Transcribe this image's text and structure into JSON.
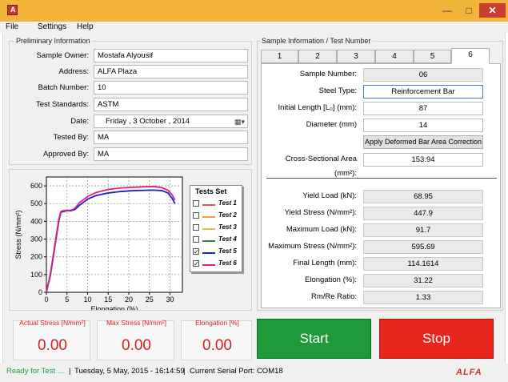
{
  "window": {
    "minimize": "—",
    "maximize": "□",
    "close": "✕",
    "icon": "alfa-app-icon"
  },
  "menu": [
    "File",
    "Settings",
    "Help"
  ],
  "preliminary": {
    "title": "Preliminary Information",
    "fields": [
      {
        "label": "Sample Owner:",
        "value": "Mostafa Alyousif"
      },
      {
        "label": "Address:",
        "value": "ALFA Plaza"
      },
      {
        "label": "Batch Number:",
        "value": "10"
      },
      {
        "label": "Test Standards:",
        "value": "ASTM"
      },
      {
        "label": "Date:",
        "value": "Friday    ,    3    October    , 2014"
      },
      {
        "label": "Tested By:",
        "value": "MA"
      },
      {
        "label": "Approved By:",
        "value": "MA"
      }
    ]
  },
  "sample_info": {
    "title": "Sample Information / Test Number",
    "tabs": [
      "1",
      "2",
      "3",
      "4",
      "5",
      "6"
    ],
    "active_tab": "6",
    "inputs": [
      {
        "label": "Sample Number:",
        "value": "06",
        "readonly": true
      },
      {
        "label": "Steel Type:",
        "value": "Reinforcement Bar",
        "readonly": false
      },
      {
        "label": "Initial Length [L₀] (mm):",
        "value": "87",
        "readonly": false
      },
      {
        "label": "Diameter (mm)",
        "value": "14",
        "readonly": false
      }
    ],
    "correction_button": "Apply Deformed Bar Area Correction",
    "area_label": "Cross-Sectional Area (mm²):",
    "area_value": "153.94",
    "results": [
      {
        "label": "Yield Load (kN):",
        "value": "68.95"
      },
      {
        "label": "Yield Stress (N/mm²):",
        "value": "447.9"
      },
      {
        "label": "Maximum Load (kN):",
        "value": "91.7"
      },
      {
        "label": "Maximum Stress (N/mm²):",
        "value": "595.69"
      },
      {
        "label": "Final Length (mm):",
        "value": "114.1614"
      },
      {
        "label": "Elongation (%):",
        "value": "31.22"
      },
      {
        "label": "Rm/Re Ratio:",
        "value": "1.33"
      }
    ]
  },
  "tests_set": {
    "title": "Tests Set",
    "items": [
      {
        "label": "Test 1",
        "checked": false,
        "color": "#d9534f"
      },
      {
        "label": "Test 2",
        "checked": false,
        "color": "#e8a040"
      },
      {
        "label": "Test 3",
        "checked": false,
        "color": "#d8c640"
      },
      {
        "label": "Test 4",
        "checked": false,
        "color": "#2a8a2a"
      },
      {
        "label": "Test 5",
        "checked": true,
        "color": "#1f1fd0"
      },
      {
        "label": "Test 6",
        "checked": true,
        "color": "#e0207a"
      }
    ]
  },
  "chart_data": {
    "type": "line",
    "xlabel": "Elongation (%)",
    "ylabel": "Stress (N/mm²)",
    "xlim": [
      0,
      33
    ],
    "ylim": [
      0,
      650
    ],
    "xticks": [
      0,
      5,
      10,
      15,
      20,
      25,
      30
    ],
    "yticks": [
      0,
      100,
      200,
      300,
      400,
      500,
      600
    ],
    "grid": true,
    "series": [
      {
        "name": "Test 5",
        "color": "#1f1fd0",
        "x": [
          0,
          1,
          2,
          3,
          3.5,
          4,
          5,
          6,
          7,
          8,
          10,
          12,
          15,
          18,
          21,
          24,
          26,
          28,
          29.5,
          30.5,
          31.2
        ],
        "y": [
          0,
          100,
          250,
          400,
          450,
          455,
          460,
          460,
          468,
          490,
          525,
          545,
          560,
          568,
          573,
          575,
          576,
          573,
          560,
          530,
          500
        ]
      },
      {
        "name": "Test 6",
        "color": "#e0207a",
        "x": [
          0,
          1,
          2,
          3,
          3.5,
          4,
          5,
          6,
          7,
          8,
          10,
          12,
          15,
          18,
          21,
          24,
          26,
          28,
          29.5,
          30.5,
          31.2
        ],
        "y": [
          0,
          110,
          260,
          410,
          455,
          460,
          462,
          463,
          475,
          505,
          540,
          562,
          580,
          588,
          592,
          595,
          596,
          590,
          575,
          550,
          520
        ]
      }
    ]
  },
  "stats": [
    {
      "title": "Actual Stress [N/mm²]",
      "value": "0.00"
    },
    {
      "title": "Max Stress [N/mm²]",
      "value": "0.00"
    },
    {
      "title": "Elongation [%]",
      "value": "0.00"
    }
  ],
  "buttons": {
    "start": "Start",
    "stop": "Stop",
    "start_color": "#1f9a3a",
    "stop_color": "#e8261f"
  },
  "status": {
    "ready": "Ready for Test ...",
    "datetime": "Tuesday, 5 May, 2015 - 16:14:59",
    "port": "Current Serial Port: COM18",
    "logo": "ALFA"
  }
}
